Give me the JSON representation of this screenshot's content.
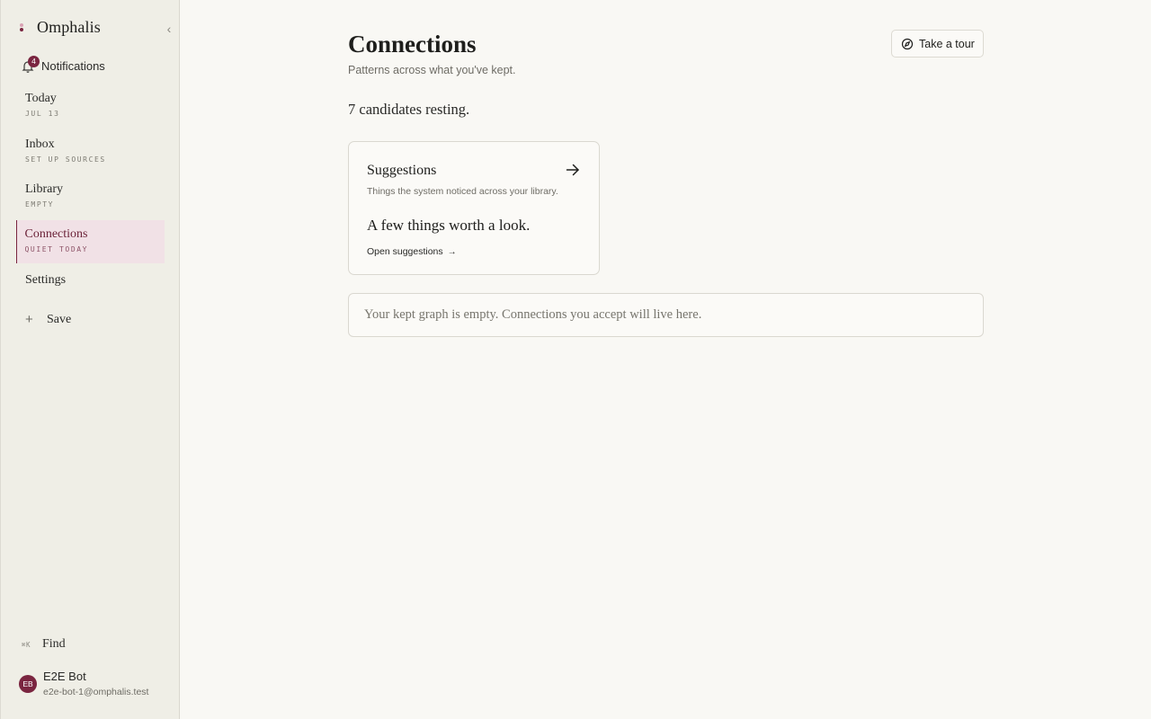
{
  "app": {
    "name": "Omphalis",
    "brand_colors": {
      "accent": "#7a2540",
      "accent_light": "#d9a3b4"
    }
  },
  "sidebar": {
    "notifications": {
      "label": "Notifications",
      "count": "4"
    },
    "items": [
      {
        "label": "Today",
        "sub": "JUL 13"
      },
      {
        "label": "Inbox",
        "sub": "SET UP SOURCES"
      },
      {
        "label": "Library",
        "sub": "EMPTY"
      },
      {
        "label": "Connections",
        "sub": "QUIET TODAY",
        "active": true
      },
      {
        "label": "Settings",
        "sub": ""
      }
    ],
    "save_label": "Save",
    "find": {
      "shortcut": "⌘K",
      "label": "Find"
    },
    "user": {
      "initials": "EB",
      "name": "E2E Bot",
      "email": "e2e-bot-1@omphalis.test"
    }
  },
  "main": {
    "title": "Connections",
    "subtitle": "Patterns across what you've kept.",
    "tour_label": "Take a tour",
    "resting_text": "7 candidates resting.",
    "suggestions_card": {
      "title": "Suggestions",
      "description": "Things the system noticed across your library.",
      "headline": "A few things worth a look.",
      "link_label": "Open suggestions",
      "link_arrow": "→"
    },
    "graph_empty_text": "Your kept graph is empty. Connections you accept will live here."
  },
  "icons": {
    "collapse": "chevron-left-icon",
    "bell": "bell-icon",
    "plus": "plus-icon",
    "compass": "compass-icon",
    "arrow": "arrow-right-icon"
  }
}
